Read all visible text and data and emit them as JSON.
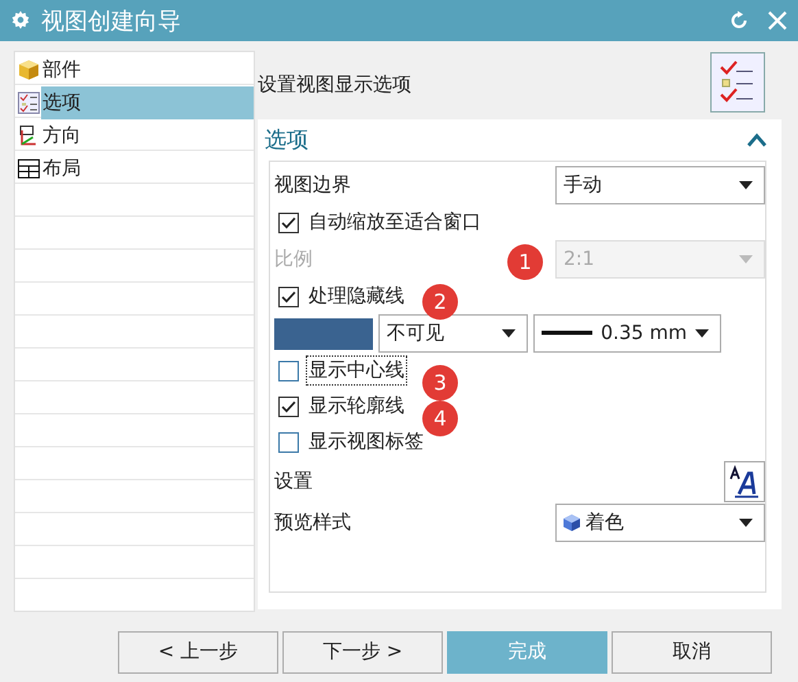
{
  "window": {
    "title": "视图创建向导"
  },
  "steps": [
    {
      "label": "部件",
      "kind": "cube",
      "selected": false
    },
    {
      "label": "选项",
      "kind": "list",
      "selected": true
    },
    {
      "label": "方向",
      "kind": "axes",
      "selected": false
    },
    {
      "label": "布局",
      "kind": "grid",
      "selected": false
    }
  ],
  "header": {
    "title": "设置视图显示选项"
  },
  "section": {
    "title": "选项",
    "expanded": true,
    "rows": [
      {
        "kind": "combo",
        "label": "视图边界",
        "value": "手动",
        "disabled": false
      },
      {
        "kind": "check",
        "label": "自动缩放至适合窗口",
        "checked": true,
        "focused": false
      },
      {
        "kind": "combo",
        "label": "比例",
        "value": "2:1",
        "disabled": true
      },
      {
        "kind": "check",
        "label": "处理隐藏线",
        "checked": true,
        "focused": false
      },
      {
        "kind": "line",
        "color": "#3a6390",
        "style": "不可见",
        "width": "0.35 mm"
      },
      {
        "kind": "check",
        "label": "显示中心线",
        "checked": false,
        "focused": true
      },
      {
        "kind": "check",
        "label": "显示轮廓线",
        "checked": true,
        "focused": false
      },
      {
        "kind": "check",
        "label": "显示视图标签",
        "checked": false,
        "focused": false
      },
      {
        "kind": "button",
        "label": "设置"
      },
      {
        "kind": "shade-combo",
        "label": "预览样式",
        "value": "着色",
        "disabled": false
      }
    ]
  },
  "annotations": [
    {
      "label": "1"
    },
    {
      "label": "2"
    },
    {
      "label": "3"
    },
    {
      "label": "4"
    }
  ],
  "buttons": [
    {
      "label": "< 上一步",
      "primary": false
    },
    {
      "label": "下一步 >",
      "primary": false
    },
    {
      "label": "完成",
      "primary": true
    },
    {
      "label": "取消",
      "primary": false
    }
  ]
}
